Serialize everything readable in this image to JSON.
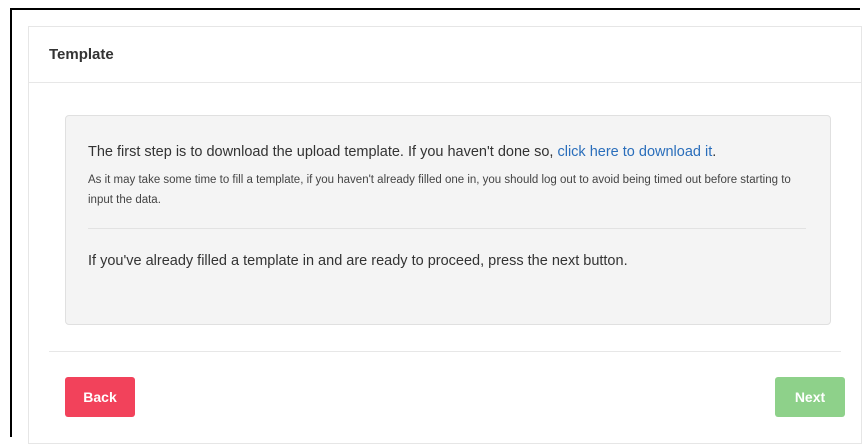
{
  "panel": {
    "title": "Template"
  },
  "instructions": {
    "step_text": "The first step is to download the upload template. If you haven't done so, ",
    "download_link": "click here to download it",
    "step_end": ".",
    "note": "As it may take some time to fill a template, if you haven't already filled one in, you should log out to avoid being timed out before starting to input the data.",
    "proceed": "If you've already filled a template in and are ready to proceed, press the next button."
  },
  "footer": {
    "back_label": "Back",
    "next_label": "Next"
  },
  "colors": {
    "back_button": "#f2425b",
    "next_button": "#8ed18a",
    "link": "#2a6ebb"
  }
}
